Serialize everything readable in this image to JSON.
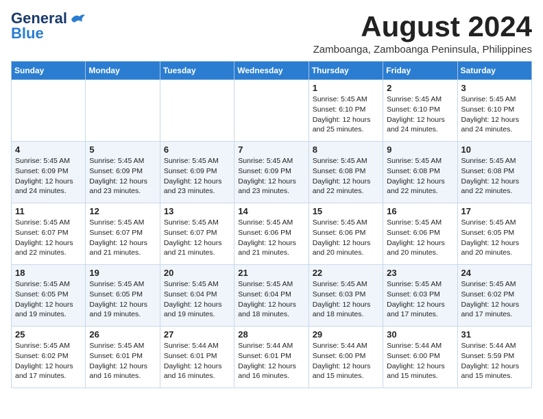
{
  "logo": {
    "text_general": "General",
    "text_blue": "Blue"
  },
  "header": {
    "month_year": "August 2024",
    "location": "Zamboanga, Zamboanga Peninsula, Philippines"
  },
  "weekdays": [
    "Sunday",
    "Monday",
    "Tuesday",
    "Wednesday",
    "Thursday",
    "Friday",
    "Saturday"
  ],
  "weeks": [
    {
      "days": [
        {
          "date": "",
          "info": ""
        },
        {
          "date": "",
          "info": ""
        },
        {
          "date": "",
          "info": ""
        },
        {
          "date": "",
          "info": ""
        },
        {
          "date": "1",
          "info": "Sunrise: 5:45 AM\nSunset: 6:10 PM\nDaylight: 12 hours\nand 25 minutes."
        },
        {
          "date": "2",
          "info": "Sunrise: 5:45 AM\nSunset: 6:10 PM\nDaylight: 12 hours\nand 24 minutes."
        },
        {
          "date": "3",
          "info": "Sunrise: 5:45 AM\nSunset: 6:10 PM\nDaylight: 12 hours\nand 24 minutes."
        }
      ]
    },
    {
      "days": [
        {
          "date": "4",
          "info": "Sunrise: 5:45 AM\nSunset: 6:09 PM\nDaylight: 12 hours\nand 24 minutes."
        },
        {
          "date": "5",
          "info": "Sunrise: 5:45 AM\nSunset: 6:09 PM\nDaylight: 12 hours\nand 23 minutes."
        },
        {
          "date": "6",
          "info": "Sunrise: 5:45 AM\nSunset: 6:09 PM\nDaylight: 12 hours\nand 23 minutes."
        },
        {
          "date": "7",
          "info": "Sunrise: 5:45 AM\nSunset: 6:09 PM\nDaylight: 12 hours\nand 23 minutes."
        },
        {
          "date": "8",
          "info": "Sunrise: 5:45 AM\nSunset: 6:08 PM\nDaylight: 12 hours\nand 22 minutes."
        },
        {
          "date": "9",
          "info": "Sunrise: 5:45 AM\nSunset: 6:08 PM\nDaylight: 12 hours\nand 22 minutes."
        },
        {
          "date": "10",
          "info": "Sunrise: 5:45 AM\nSunset: 6:08 PM\nDaylight: 12 hours\nand 22 minutes."
        }
      ]
    },
    {
      "days": [
        {
          "date": "11",
          "info": "Sunrise: 5:45 AM\nSunset: 6:07 PM\nDaylight: 12 hours\nand 22 minutes."
        },
        {
          "date": "12",
          "info": "Sunrise: 5:45 AM\nSunset: 6:07 PM\nDaylight: 12 hours\nand 21 minutes."
        },
        {
          "date": "13",
          "info": "Sunrise: 5:45 AM\nSunset: 6:07 PM\nDaylight: 12 hours\nand 21 minutes."
        },
        {
          "date": "14",
          "info": "Sunrise: 5:45 AM\nSunset: 6:06 PM\nDaylight: 12 hours\nand 21 minutes."
        },
        {
          "date": "15",
          "info": "Sunrise: 5:45 AM\nSunset: 6:06 PM\nDaylight: 12 hours\nand 20 minutes."
        },
        {
          "date": "16",
          "info": "Sunrise: 5:45 AM\nSunset: 6:06 PM\nDaylight: 12 hours\nand 20 minutes."
        },
        {
          "date": "17",
          "info": "Sunrise: 5:45 AM\nSunset: 6:05 PM\nDaylight: 12 hours\nand 20 minutes."
        }
      ]
    },
    {
      "days": [
        {
          "date": "18",
          "info": "Sunrise: 5:45 AM\nSunset: 6:05 PM\nDaylight: 12 hours\nand 19 minutes."
        },
        {
          "date": "19",
          "info": "Sunrise: 5:45 AM\nSunset: 6:05 PM\nDaylight: 12 hours\nand 19 minutes."
        },
        {
          "date": "20",
          "info": "Sunrise: 5:45 AM\nSunset: 6:04 PM\nDaylight: 12 hours\nand 19 minutes."
        },
        {
          "date": "21",
          "info": "Sunrise: 5:45 AM\nSunset: 6:04 PM\nDaylight: 12 hours\nand 18 minutes."
        },
        {
          "date": "22",
          "info": "Sunrise: 5:45 AM\nSunset: 6:03 PM\nDaylight: 12 hours\nand 18 minutes."
        },
        {
          "date": "23",
          "info": "Sunrise: 5:45 AM\nSunset: 6:03 PM\nDaylight: 12 hours\nand 17 minutes."
        },
        {
          "date": "24",
          "info": "Sunrise: 5:45 AM\nSunset: 6:02 PM\nDaylight: 12 hours\nand 17 minutes."
        }
      ]
    },
    {
      "days": [
        {
          "date": "25",
          "info": "Sunrise: 5:45 AM\nSunset: 6:02 PM\nDaylight: 12 hours\nand 17 minutes."
        },
        {
          "date": "26",
          "info": "Sunrise: 5:45 AM\nSunset: 6:01 PM\nDaylight: 12 hours\nand 16 minutes."
        },
        {
          "date": "27",
          "info": "Sunrise: 5:44 AM\nSunset: 6:01 PM\nDaylight: 12 hours\nand 16 minutes."
        },
        {
          "date": "28",
          "info": "Sunrise: 5:44 AM\nSunset: 6:01 PM\nDaylight: 12 hours\nand 16 minutes."
        },
        {
          "date": "29",
          "info": "Sunrise: 5:44 AM\nSunset: 6:00 PM\nDaylight: 12 hours\nand 15 minutes."
        },
        {
          "date": "30",
          "info": "Sunrise: 5:44 AM\nSunset: 6:00 PM\nDaylight: 12 hours\nand 15 minutes."
        },
        {
          "date": "31",
          "info": "Sunrise: 5:44 AM\nSunset: 5:59 PM\nDaylight: 12 hours\nand 15 minutes."
        }
      ]
    }
  ]
}
